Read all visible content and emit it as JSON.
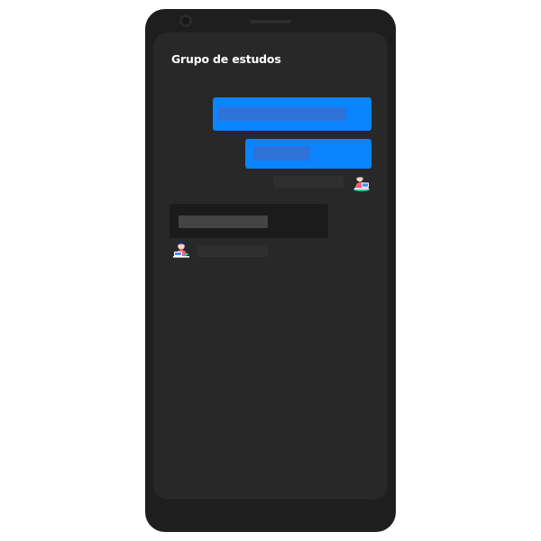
{
  "app": {
    "title": "Grupo de estudos"
  },
  "colors": {
    "device_frame": "#1e1e1e",
    "screen_background": "#282828",
    "sent_bubble": "#0a84ff",
    "received_bubble": "#1b1b1b"
  },
  "messages": [
    {
      "direction": "outgoing",
      "text_redacted": true
    },
    {
      "direction": "outgoing",
      "text_redacted": true
    },
    {
      "direction": "incoming",
      "text_redacted": true
    }
  ],
  "avatars": {
    "outgoing_icon": "person-with-laptop-avatar",
    "incoming_icon": "person-with-laptop-avatar"
  }
}
